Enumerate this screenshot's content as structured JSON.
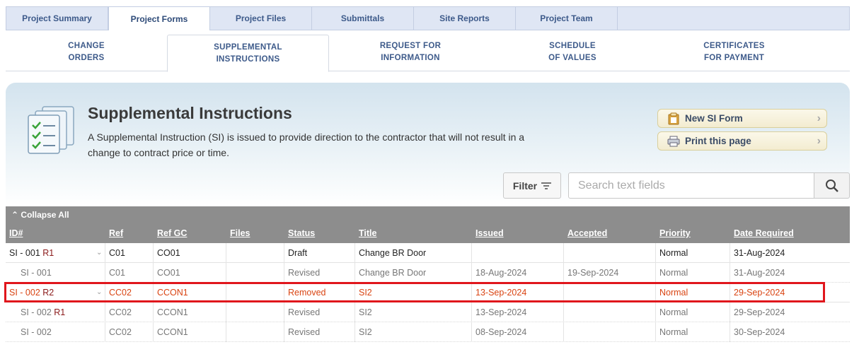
{
  "top_tabs": [
    "Project Summary",
    "Project Forms",
    "Project Files",
    "Submittals",
    "Site Reports",
    "Project Team"
  ],
  "sub_tabs": [
    "CHANGE\nORDERS",
    "SUPPLEMENTAL\nINSTRUCTIONS",
    "REQUEST FOR\nINFORMATION",
    "SCHEDULE\nOF VALUES",
    "CERTIFICATES\nFOR PAYMENT"
  ],
  "panel": {
    "title": "Supplemental Instructions",
    "description": "A Supplemental Instruction (SI) is issued to provide direction to the contractor that will not result in a change to contract price or time.",
    "new_form_label": "New SI Form",
    "print_label": "Print this page"
  },
  "toolbar": {
    "filter_label": "Filter",
    "search_placeholder": "Search text fields"
  },
  "grid": {
    "collapse_label": "Collapse All",
    "columns": [
      "ID#",
      "Ref",
      "Ref GC",
      "Files",
      "Status",
      "Title",
      "Issued",
      "Accepted",
      "Priority",
      "Date Required"
    ],
    "rows": [
      {
        "id": "SI - 001 ",
        "rev": "R1",
        "ref": "C01",
        "refgc": "CO01",
        "files": "",
        "status": "Draft",
        "title": "Change BR Door",
        "issued": "",
        "accepted": "",
        "priority": "Normal",
        "date_required": "31-Aug-2024"
      },
      {
        "id": "SI - 001",
        "rev": "",
        "ref": "C01",
        "refgc": "CO01",
        "files": "",
        "status": "Revised",
        "title": "Change BR Door",
        "issued": "18-Aug-2024",
        "accepted": "19-Sep-2024",
        "priority": "Normal",
        "date_required": "31-Aug-2024"
      },
      {
        "id": "SI - 002 ",
        "rev": "R2",
        "ref": "CC02",
        "refgc": "CCON1",
        "files": "",
        "status": "Removed",
        "title": "SI2",
        "issued": "13-Sep-2024",
        "accepted": "",
        "priority": "Normal",
        "date_required": "29-Sep-2024"
      },
      {
        "id": "SI - 002 ",
        "rev": "R1",
        "ref": "CC02",
        "refgc": "CCON1",
        "files": "",
        "status": "Revised",
        "title": "SI2",
        "issued": "13-Sep-2024",
        "accepted": "",
        "priority": "Normal",
        "date_required": "29-Sep-2024"
      },
      {
        "id": "SI - 002",
        "rev": "",
        "ref": "CC02",
        "refgc": "CCON1",
        "files": "",
        "status": "Revised",
        "title": "SI2",
        "issued": "08-Sep-2024",
        "accepted": "",
        "priority": "Normal",
        "date_required": "30-Sep-2024"
      }
    ]
  },
  "colors": {
    "accent": "#3d5a8a",
    "removed": "#d94412",
    "highlight": "#e0161c",
    "header_bg": "#8d8d8d"
  }
}
